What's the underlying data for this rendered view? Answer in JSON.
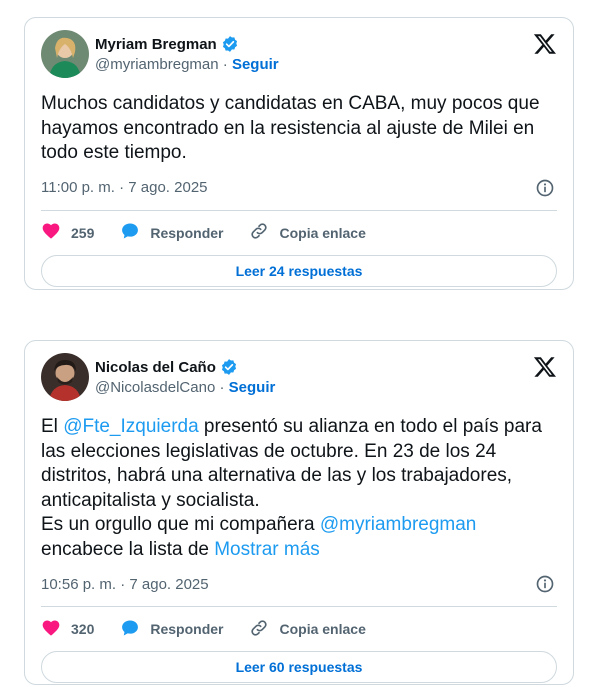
{
  "tweets": [
    {
      "name": "Myriam Bregman",
      "handle": "@myriambregman",
      "dot": "·",
      "follow": "Seguir",
      "text_parts": [
        "Muchos candidatos y candidatas en CABA, muy pocos que hayamos encontrado en la resistencia al ajuste de Milei en todo este tiempo."
      ],
      "timestamp": "11:00 p. m. · 7 ago. 2025",
      "likes": "259",
      "reply": "Responder",
      "copy_link": "Copia enlace",
      "read_replies": "Leer 24 respuestas"
    },
    {
      "name": "Nicolas del Caño",
      "handle": "@NicolasdelCano",
      "dot": "·",
      "follow": "Seguir",
      "text_parts": [
        "El ",
        "@Fte_Izquierda",
        " presentó su alianza en todo el país para las elecciones legislativas de octubre. En 23 de los 24 distritos, habrá una alternativa de las y los trabajadores, anticapitalista y socialista.",
        "Es un orgullo que mi compañera ",
        "@myriambregman",
        "encabece la lista de ",
        "Mostrar más"
      ],
      "timestamp": "10:56 p. m. · 7 ago. 2025",
      "likes": "320",
      "reply": "Responder",
      "copy_link": "Copia enlace",
      "read_replies": "Leer 60 respuestas"
    }
  ],
  "colors": {
    "accent": "#1d9bf0",
    "link_dark": "#006fd6",
    "like": "#f91880",
    "muted": "#536471",
    "border": "#cfd9de"
  },
  "icons": [
    "verified-badge-icon",
    "x-logo-icon",
    "info-icon",
    "heart-icon",
    "reply-bubble-icon",
    "link-icon"
  ]
}
